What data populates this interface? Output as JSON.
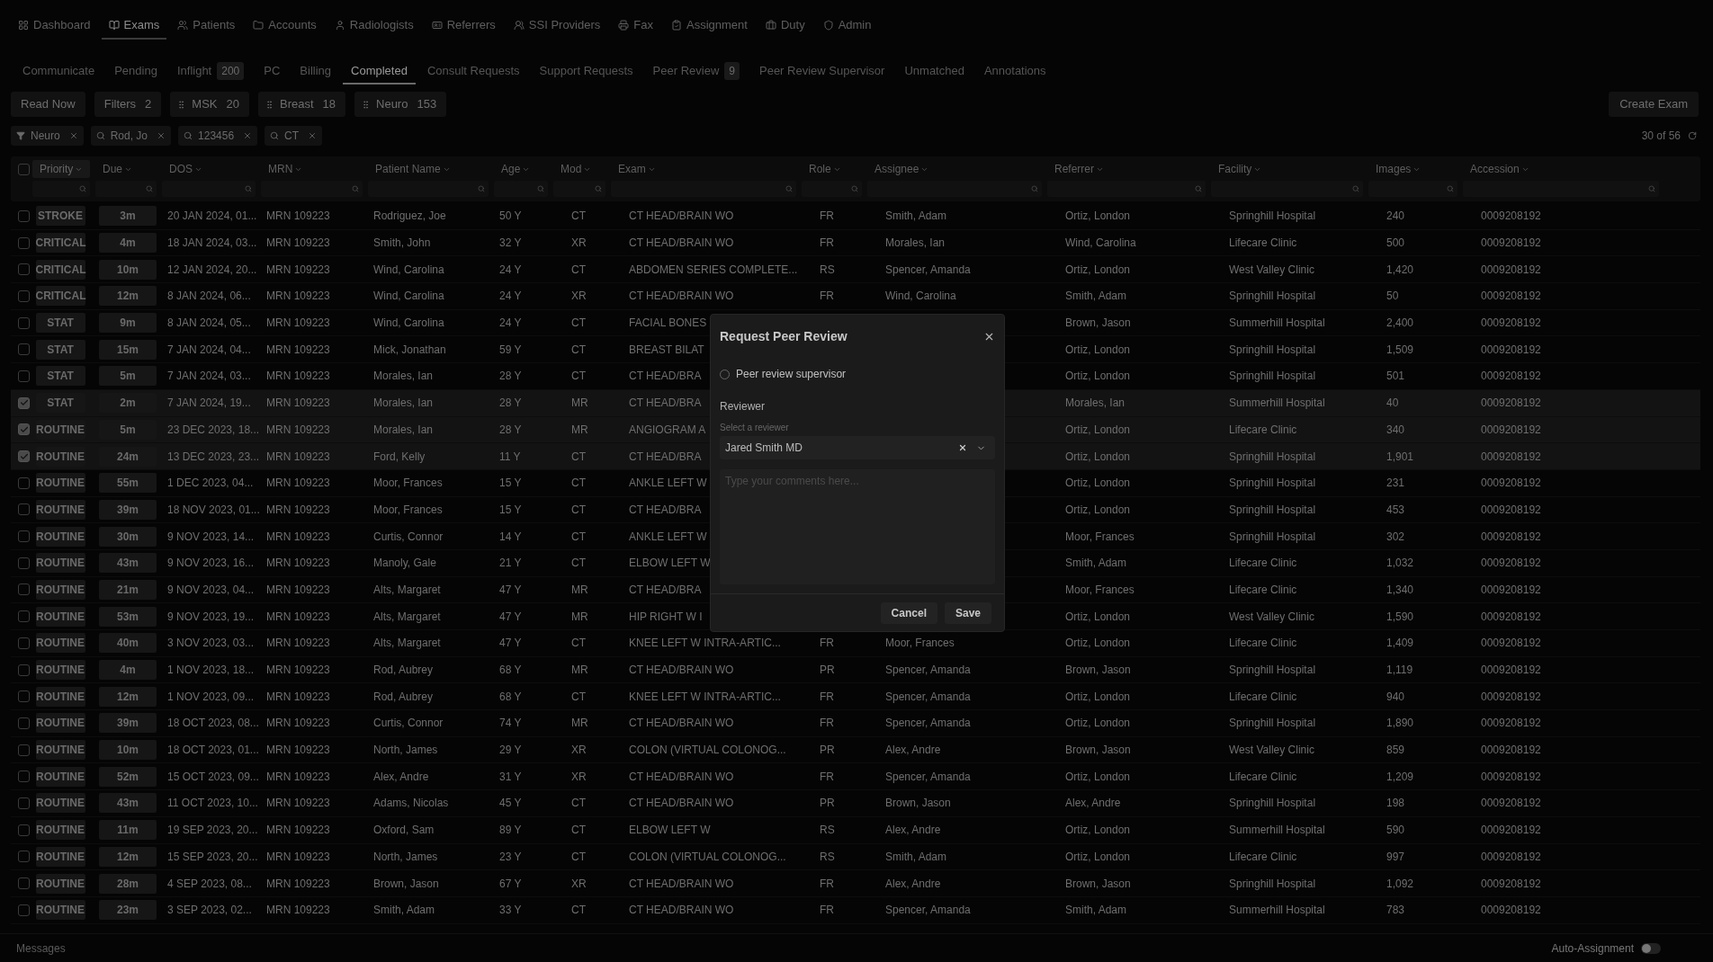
{
  "nav": [
    {
      "label": "Dashboard",
      "selected": false
    },
    {
      "label": "Exams",
      "selected": true
    },
    {
      "label": "Patients",
      "selected": false
    },
    {
      "label": "Accounts",
      "selected": false
    },
    {
      "label": "Radiologists",
      "selected": false
    },
    {
      "label": "Referrers",
      "selected": false
    },
    {
      "label": "SSI Providers",
      "selected": false
    },
    {
      "label": "Fax",
      "selected": false
    },
    {
      "label": "Assignment",
      "selected": false
    },
    {
      "label": "Duty",
      "selected": false
    },
    {
      "label": "Admin",
      "selected": false
    }
  ],
  "tabs": [
    {
      "label": "Communicate",
      "selected": false
    },
    {
      "label": "Pending",
      "selected": false
    },
    {
      "label": "Inflight",
      "count": "200",
      "selected": false
    },
    {
      "label": "PC",
      "selected": false
    },
    {
      "label": "Billing",
      "selected": false
    },
    {
      "label": "Completed",
      "selected": true
    },
    {
      "label": "Consult Requests",
      "selected": false
    },
    {
      "label": "Support Requests",
      "selected": false
    },
    {
      "label": "Peer Review",
      "count": "9",
      "selected": false
    },
    {
      "label": "Peer Review Supervisor",
      "selected": false
    },
    {
      "label": "Unmatched",
      "selected": false
    },
    {
      "label": "Annotations",
      "selected": false
    }
  ],
  "quick_filters": [
    {
      "kind": "plain",
      "label": "Read Now"
    },
    {
      "kind": "plain",
      "label": "Filters",
      "count": "2"
    },
    {
      "kind": "handle",
      "label": "MSK",
      "count": "20"
    },
    {
      "kind": "handle",
      "label": "Breast",
      "count": "18"
    },
    {
      "kind": "handle",
      "label": "Neuro",
      "count": "153"
    }
  ],
  "create_button": "Create Exam",
  "chips": [
    {
      "kind": "filter",
      "label": "Neuro"
    },
    {
      "kind": "search",
      "label": "Rod, Jo"
    },
    {
      "kind": "search",
      "label": "123456"
    },
    {
      "kind": "search",
      "label": "CT"
    }
  ],
  "result_count": "30 of 56",
  "table": {
    "all_checked": false,
    "columns": [
      {
        "label": "Priority",
        "selected": true
      },
      {
        "label": "Due",
        "selected": false
      },
      {
        "label": "DOS",
        "selected": false
      },
      {
        "label": "MRN",
        "selected": false
      },
      {
        "label": "Patient Name",
        "selected": false
      },
      {
        "label": "Age",
        "selected": false
      },
      {
        "label": "Mod",
        "selected": false
      },
      {
        "label": "Exam",
        "selected": false
      },
      {
        "label": "Role",
        "selected": false
      },
      {
        "label": "Assignee",
        "selected": false
      },
      {
        "label": "Referrer",
        "selected": false
      },
      {
        "label": "Facility",
        "selected": false
      },
      {
        "label": "Images",
        "selected": false
      },
      {
        "label": "Accession",
        "selected": false
      }
    ],
    "rows": [
      {
        "checked": false,
        "priority": "STROKE",
        "due": "3m",
        "dos": "20 JAN 2024, 01...",
        "mrn": "MRN 109223",
        "patient": "Rodriguez, Joe",
        "age": "50 Y",
        "mod": "CT",
        "exam": "CT HEAD/BRAIN WO",
        "role": "FR",
        "assignee": "Smith, Adam",
        "referrer": "Ortiz, London",
        "facility": "Springhill Hospital",
        "images": "240",
        "accession": "0009208192"
      },
      {
        "checked": false,
        "priority": "CRITICAL",
        "due": "4m",
        "dos": "18 JAN 2024, 03...",
        "mrn": "MRN 109223",
        "patient": "Smith, John",
        "age": "32 Y",
        "mod": "XR",
        "exam": "CT HEAD/BRAIN WO",
        "role": "FR",
        "assignee": "Morales, Ian",
        "referrer": "Wind, Carolina",
        "facility": "Lifecare Clinic",
        "images": "500",
        "accession": "0009208192"
      },
      {
        "checked": false,
        "priority": "CRITICAL",
        "due": "10m",
        "dos": "12 JAN 2024, 20...",
        "mrn": "MRN 109223",
        "patient": "Wind, Carolina",
        "age": "24 Y",
        "mod": "CT",
        "exam": "ABDOMEN SERIES COMPLETE...",
        "role": "RS",
        "assignee": "Spencer, Amanda",
        "referrer": "Ortiz, London",
        "facility": "West Valley Clinic",
        "images": "1,420",
        "accession": "0009208192"
      },
      {
        "checked": false,
        "priority": "CRITICAL",
        "due": "12m",
        "dos": "8 JAN 2024, 06...",
        "mrn": "MRN 109223",
        "patient": "Wind, Carolina",
        "age": "24 Y",
        "mod": "XR",
        "exam": "CT HEAD/BRAIN WO",
        "role": "FR",
        "assignee": "Wind, Carolina",
        "referrer": "Smith, Adam",
        "facility": "Springhill Hospital",
        "images": "50",
        "accession": "0009208192"
      },
      {
        "checked": false,
        "priority": "STAT",
        "due": "9m",
        "dos": "8 JAN 2024, 05...",
        "mrn": "MRN 109223",
        "patient": "Wind, Carolina",
        "age": "24 Y",
        "mod": "CT",
        "exam": "FACIAL BONES",
        "referrer": "Brown, Jason",
        "facility": "Summerhill Hospital",
        "images": "2,400",
        "accession": "0009208192"
      },
      {
        "checked": false,
        "priority": "STAT",
        "due": "15m",
        "dos": "7 JAN 2024, 04...",
        "mrn": "MRN 109223",
        "patient": "Mick, Jonathan",
        "age": "59 Y",
        "mod": "CT",
        "exam": "BREAST BILAT",
        "referrer": "Ortiz, London",
        "facility": "Springhill Hospital",
        "images": "1,509",
        "accession": "0009208192"
      },
      {
        "checked": false,
        "priority": "STAT",
        "due": "5m",
        "dos": "7 JAN 2024, 03...",
        "mrn": "MRN 109223",
        "patient": "Morales, Ian",
        "age": "28 Y",
        "mod": "CT",
        "exam": "CT HEAD/BRA",
        "referrer": "Ortiz, London",
        "facility": "Springhill Hospital",
        "images": "501",
        "accession": "0009208192"
      },
      {
        "checked": true,
        "priority": "STAT",
        "due": "2m",
        "dos": "7 JAN 2024, 19...",
        "mrn": "MRN 109223",
        "patient": "Morales, Ian",
        "age": "28 Y",
        "mod": "MR",
        "exam": "CT HEAD/BRA",
        "referrer": "Morales, Ian",
        "facility": "Summerhill Hospital",
        "images": "40",
        "accession": "0009208192"
      },
      {
        "checked": true,
        "priority": "ROUTINE",
        "due": "5m",
        "dos": "23 DEC 2023, 18...",
        "mrn": "MRN 109223",
        "patient": "Morales, Ian",
        "age": "28 Y",
        "mod": "MR",
        "exam": "ANGIOGRAM A",
        "referrer": "Ortiz, London",
        "facility": "Lifecare Clinic",
        "images": "340",
        "accession": "0009208192"
      },
      {
        "checked": true,
        "priority": "ROUTINE",
        "due": "24m",
        "dos": "13 DEC 2023, 23...",
        "mrn": "MRN 109223",
        "patient": "Ford, Kelly",
        "age": "11 Y",
        "mod": "CT",
        "exam": "CT HEAD/BRA",
        "referrer": "Ortiz, London",
        "facility": "Springhill Hospital",
        "images": "1,901",
        "accession": "0009208192"
      },
      {
        "checked": false,
        "priority": "ROUTINE",
        "due": "55m",
        "dos": "1 DEC 2023, 04...",
        "mrn": "MRN 109223",
        "patient": "Moor, Frances",
        "age": "15 Y",
        "mod": "CT",
        "exam": "ANKLE LEFT W",
        "referrer": "Ortiz, London",
        "facility": "Springhill Hospital",
        "images": "231",
        "accession": "0009208192"
      },
      {
        "checked": false,
        "priority": "ROUTINE",
        "due": "39m",
        "dos": "18 NOV 2023, 01...",
        "mrn": "MRN 109223",
        "patient": "Moor, Frances",
        "age": "15 Y",
        "mod": "CT",
        "exam": "CT HEAD/BRA",
        "referrer": "Ortiz, London",
        "facility": "Springhill Hospital",
        "images": "453",
        "accession": "0009208192"
      },
      {
        "checked": false,
        "priority": "ROUTINE",
        "due": "30m",
        "dos": "9 NOV 2023, 14...",
        "mrn": "MRN 109223",
        "patient": "Curtis, Connor",
        "age": "14 Y",
        "mod": "CT",
        "exam": "ANKLE LEFT W",
        "referrer": "Moor, Frances",
        "facility": "Springhill Hospital",
        "images": "302",
        "accession": "0009208192"
      },
      {
        "checked": false,
        "priority": "ROUTINE",
        "due": "43m",
        "dos": "9 NOV 2023, 16...",
        "mrn": "MRN 109223",
        "patient": "Manoly, Gale",
        "age": "21 Y",
        "mod": "CT",
        "exam": "ELBOW LEFT W",
        "referrer": "Smith, Adam",
        "facility": "Lifecare Clinic",
        "images": "1,032",
        "accession": "0009208192"
      },
      {
        "checked": false,
        "priority": "ROUTINE",
        "due": "21m",
        "dos": "9 NOV 2023, 04...",
        "mrn": "MRN 109223",
        "patient": "Alts, Margaret",
        "age": "47 Y",
        "mod": "MR",
        "exam": "CT HEAD/BRA",
        "referrer": "Moor, Frances",
        "facility": "Lifecare Clinic",
        "images": "1,340",
        "accession": "0009208192"
      },
      {
        "checked": false,
        "priority": "ROUTINE",
        "due": "53m",
        "dos": "9 NOV 2023, 19...",
        "mrn": "MRN 109223",
        "patient": "Alts, Margaret",
        "age": "47 Y",
        "mod": "MR",
        "exam": "HIP RIGHT W I",
        "referrer": "Ortiz, London",
        "facility": "West Valley Clinic",
        "images": "1,590",
        "accession": "0009208192"
      },
      {
        "checked": false,
        "priority": "ROUTINE",
        "due": "40m",
        "dos": "3 NOV 2023, 03...",
        "mrn": "MRN 109223",
        "patient": "Alts, Margaret",
        "age": "47 Y",
        "mod": "CT",
        "exam": "KNEE LEFT W INTRA-ARTIC...",
        "role": "FR",
        "assignee": "Moor, Frances",
        "referrer": "Ortiz, London",
        "facility": "Lifecare Clinic",
        "images": "1,409",
        "accession": "0009208192"
      },
      {
        "checked": false,
        "priority": "ROUTINE",
        "due": "4m",
        "dos": "1 NOV 2023, 18...",
        "mrn": "MRN 109223",
        "patient": "Rod, Aubrey",
        "age": "68 Y",
        "mod": "MR",
        "exam": "CT HEAD/BRAIN WO",
        "role": "PR",
        "assignee": "Spencer, Amanda",
        "referrer": "Brown, Jason",
        "facility": "Springhill Hospital",
        "images": "1,119",
        "accession": "0009208192"
      },
      {
        "checked": false,
        "priority": "ROUTINE",
        "due": "12m",
        "dos": "1 NOV 2023, 09...",
        "mrn": "MRN 109223",
        "patient": "Rod, Aubrey",
        "age": "68 Y",
        "mod": "CT",
        "exam": "KNEE LEFT W INTRA-ARTIC...",
        "role": "FR",
        "assignee": "Spencer, Amanda",
        "referrer": "Ortiz, London",
        "facility": "Lifecare Clinic",
        "images": "940",
        "accession": "0009208192"
      },
      {
        "checked": false,
        "priority": "ROUTINE",
        "due": "39m",
        "dos": "18 OCT 2023, 08...",
        "mrn": "MRN 109223",
        "patient": "Curtis, Connor",
        "age": "74 Y",
        "mod": "MR",
        "exam": "CT HEAD/BRAIN WO",
        "role": "FR",
        "assignee": "Spencer, Amanda",
        "referrer": "Ortiz, London",
        "facility": "Springhill Hospital",
        "images": "1,890",
        "accession": "0009208192"
      },
      {
        "checked": false,
        "priority": "ROUTINE",
        "due": "10m",
        "dos": "18 OCT 2023, 01...",
        "mrn": "MRN 109223",
        "patient": "North, James",
        "age": "29 Y",
        "mod": "XR",
        "exam": "COLON (VIRTUAL COLONOG...",
        "role": "PR",
        "assignee": "Alex, Andre",
        "referrer": "Brown, Jason",
        "facility": "West Valley Clinic",
        "images": "859",
        "accession": "0009208192"
      },
      {
        "checked": false,
        "priority": "ROUTINE",
        "due": "52m",
        "dos": "15 OCT 2023, 09...",
        "mrn": "MRN 109223",
        "patient": "Alex, Andre",
        "age": "31 Y",
        "mod": "XR",
        "exam": "CT HEAD/BRAIN WO",
        "role": "FR",
        "assignee": "Spencer, Amanda",
        "referrer": "Ortiz, London",
        "facility": "Lifecare Clinic",
        "images": "1,209",
        "accession": "0009208192"
      },
      {
        "checked": false,
        "priority": "ROUTINE",
        "due": "43m",
        "dos": "11 OCT 2023, 10...",
        "mrn": "MRN 109223",
        "patient": "Adams, Nicolas",
        "age": "45 Y",
        "mod": "CT",
        "exam": "CT HEAD/BRAIN WO",
        "role": "PR",
        "assignee": "Brown, Jason",
        "referrer": "Alex, Andre",
        "facility": "Springhill Hospital",
        "images": "198",
        "accession": "0009208192"
      },
      {
        "checked": false,
        "priority": "ROUTINE",
        "due": "11m",
        "dos": "19 SEP 2023, 20...",
        "mrn": "MRN 109223",
        "patient": "Oxford, Sam",
        "age": "89 Y",
        "mod": "CT",
        "exam": "ELBOW LEFT W",
        "role": "RS",
        "assignee": "Alex, Andre",
        "referrer": "Ortiz, London",
        "facility": "Summerhill Hospital",
        "images": "590",
        "accession": "0009208192"
      },
      {
        "checked": false,
        "priority": "ROUTINE",
        "due": "12m",
        "dos": "15 SEP 2023, 20...",
        "mrn": "MRN 109223",
        "patient": "North, James",
        "age": "23 Y",
        "mod": "CT",
        "exam": "COLON (VIRTUAL COLONOG...",
        "role": "RS",
        "assignee": "Smith, Adam",
        "referrer": "Ortiz, London",
        "facility": "Lifecare Clinic",
        "images": "997",
        "accession": "0009208192"
      },
      {
        "checked": false,
        "priority": "ROUTINE",
        "due": "28m",
        "dos": "4 SEP 2023, 08...",
        "mrn": "MRN 109223",
        "patient": "Brown, Jason",
        "age": "67 Y",
        "mod": "XR",
        "exam": "CT HEAD/BRAIN WO",
        "role": "FR",
        "assignee": "Alex, Andre",
        "referrer": "Brown, Jason",
        "facility": "Springhill Hospital",
        "images": "1,092",
        "accession": "0009208192"
      },
      {
        "checked": false,
        "priority": "ROUTINE",
        "due": "23m",
        "dos": "3 SEP 2023, 02...",
        "mrn": "MRN 109223",
        "patient": "Smith, Adam",
        "age": "33 Y",
        "mod": "CT",
        "exam": "CT HEAD/BRAIN WO",
        "role": "FR",
        "assignee": "Spencer, Amanda",
        "referrer": "Smith, Adam",
        "facility": "Summerhill Hospital",
        "images": "783",
        "accession": "0009208192"
      }
    ]
  },
  "footer": {
    "messages": "Messages",
    "auto_assignment": {
      "label": "Auto-Assignment",
      "on": false
    }
  },
  "dialog": {
    "title": "Request Peer Review",
    "radio": {
      "label": "Peer review supervisor",
      "selected": false
    },
    "section": "Reviewer",
    "select_label": "Select a reviewer",
    "select_value": "Jared Smith MD",
    "comments_placeholder": "Type your comments here...",
    "buttons": [
      "Cancel",
      "Save"
    ]
  }
}
